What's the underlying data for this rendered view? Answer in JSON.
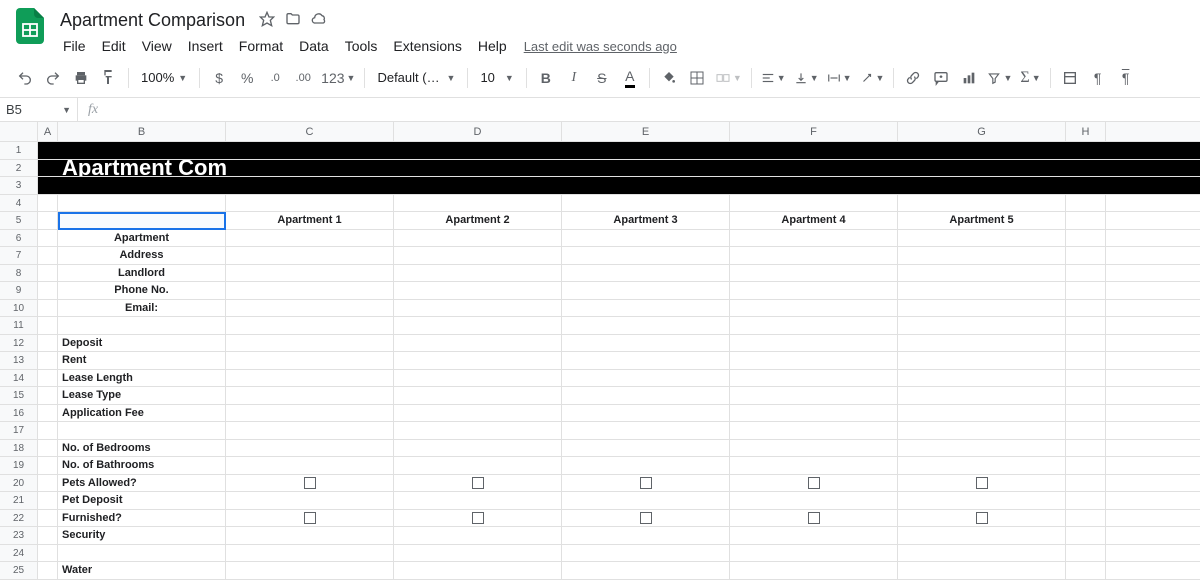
{
  "doc": {
    "title": "Apartment Comparison"
  },
  "menus": {
    "file": "File",
    "edit": "Edit",
    "view": "View",
    "insert": "Insert",
    "format": "Format",
    "data": "Data",
    "tools": "Tools",
    "extensions": "Extensions",
    "help": "Help"
  },
  "last_edit": "Last edit was seconds ago",
  "toolbar": {
    "zoom": "100%",
    "currency": "$",
    "percent": "%",
    "dec_less": ".0",
    "dec_more": ".00",
    "num_fmt": "123",
    "font": "Default (Ari...",
    "font_size": "10"
  },
  "name_box": "B5",
  "formula": "",
  "columns": [
    "A",
    "B",
    "C",
    "D",
    "E",
    "F",
    "G",
    "H"
  ],
  "rows": [
    "1",
    "2",
    "3",
    "4",
    "5",
    "6",
    "7",
    "8",
    "9",
    "10",
    "11",
    "12",
    "13",
    "14",
    "15",
    "16",
    "17",
    "18",
    "19",
    "20",
    "21",
    "22",
    "23",
    "24",
    "25"
  ],
  "sheet": {
    "title": "Apartment Comparison",
    "headers": {
      "c": "Apartment 1",
      "d": "Apartment 2",
      "e": "Apartment 3",
      "f": "Apartment 4",
      "g": "Apartment 5"
    },
    "labels": {
      "r6": "Apartment",
      "r7": "Address",
      "r8": "Landlord",
      "r9": "Phone No.",
      "r10": "Email:",
      "r12": "Deposit",
      "r13": "Rent",
      "r14": "Lease Length",
      "r15": "Lease Type",
      "r16": "Application Fee",
      "r18": "No. of Bedrooms",
      "r19": "No. of Bathrooms",
      "r20": "Pets Allowed?",
      "r21": "Pet Deposit",
      "r22": "Furnished?",
      "r23": "Security",
      "r25": "Water"
    }
  }
}
